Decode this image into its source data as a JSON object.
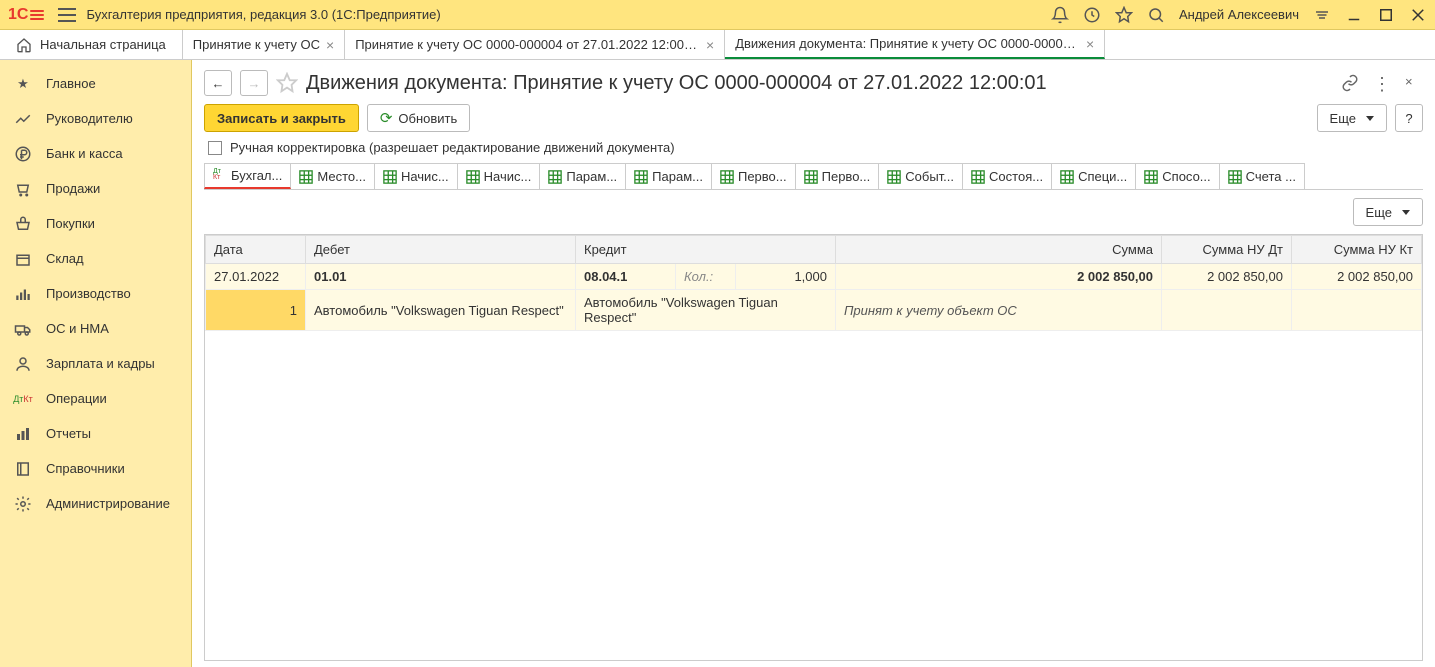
{
  "titlebar": {
    "app_title": "Бухгалтерия предприятия, редакция 3.0  (1С:Предприятие)",
    "user": "Андрей Алексеевич"
  },
  "tabs": {
    "home": "Начальная страница",
    "items": [
      {
        "label": "Принятие к учету ОС"
      },
      {
        "label": "Принятие к учету ОС 0000-000004 от 27.01.2022 12:00:01"
      },
      {
        "label": "Движения документа: Принятие к учету ОС 0000-000004 от 27.01.2022 12:00:01"
      }
    ]
  },
  "sidebar": [
    {
      "label": "Главное",
      "icon": "star"
    },
    {
      "label": "Руководителю",
      "icon": "chart"
    },
    {
      "label": "Банк и касса",
      "icon": "ruble"
    },
    {
      "label": "Продажи",
      "icon": "cart"
    },
    {
      "label": "Покупки",
      "icon": "basket"
    },
    {
      "label": "Склад",
      "icon": "box"
    },
    {
      "label": "Производство",
      "icon": "factory"
    },
    {
      "label": "ОС и НМА",
      "icon": "truck"
    },
    {
      "label": "Зарплата и кадры",
      "icon": "person"
    },
    {
      "label": "Операции",
      "icon": "dtkt"
    },
    {
      "label": "Отчеты",
      "icon": "bars"
    },
    {
      "label": "Справочники",
      "icon": "book"
    },
    {
      "label": "Администрирование",
      "icon": "gear"
    }
  ],
  "page": {
    "title": "Движения документа: Принятие к учету ОС 0000-000004 от 27.01.2022 12:00:01",
    "write_close": "Записать и закрыть",
    "refresh": "Обновить",
    "more": "Еще",
    "help": "?",
    "manual_check": "Ручная корректировка (разрешает редактирование движений документа)"
  },
  "subtabs": [
    "Бухгал...",
    "Место...",
    "Начис...",
    "Начис...",
    "Парам...",
    "Парам...",
    "Перво...",
    "Перво...",
    "Событ...",
    "Состоя...",
    "Специ...",
    "Спосо...",
    "Счета ..."
  ],
  "table": {
    "headers": [
      "Дата",
      "Дебет",
      "Кредит",
      "Сумма",
      "Сумма НУ Дт",
      "Сумма НУ Кт"
    ],
    "more": "Еще",
    "row1": {
      "date": "27.01.2022",
      "debit_acct": "01.01",
      "credit_acct": "08.04.1",
      "qty_label": "Кол.:",
      "qty": "1,000",
      "sum": "2 002 850,00",
      "sum_nu_dt": "2 002 850,00",
      "sum_nu_kt": "2 002 850,00"
    },
    "row2": {
      "num": "1",
      "debit_obj": "Автомобиль \"Volkswagen Tiguan Respect\"",
      "credit_obj": "Автомобиль \"Volkswagen Tiguan Respect\"",
      "comment": "Принят к учету объект ОС"
    }
  }
}
